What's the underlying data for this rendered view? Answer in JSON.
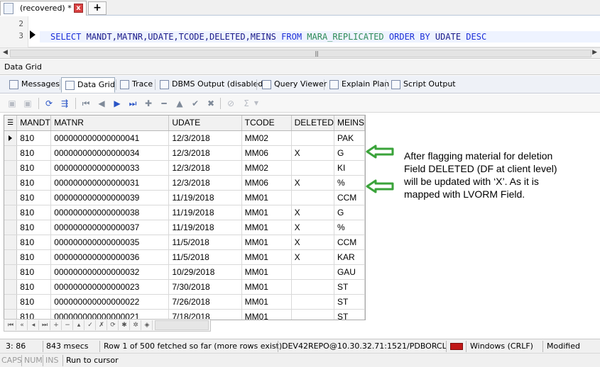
{
  "doc_tab": {
    "title": "(recovered) *",
    "icon_text": "SQL",
    "close_label": "x",
    "new_tab_label": "+"
  },
  "editor": {
    "line_numbers": [
      "2",
      "3"
    ],
    "sql": {
      "select": "SELECT",
      "columns": "MANDT,MATNR,UDATE,TCODE,DELETED,MEINS",
      "from": "FROM",
      "table": "MARA_REPLICATED",
      "order_by": "ORDER BY",
      "order_col": "UDATE",
      "desc": "DESC"
    }
  },
  "pane_title": "Data Grid",
  "result_tabs": [
    {
      "label": "Messages",
      "icon": "messages-icon"
    },
    {
      "label": "Data Grid",
      "icon": "data-grid-icon",
      "active": true
    },
    {
      "label": "Trace",
      "icon": "trace-icon"
    },
    {
      "label": "DBMS Output (disabled)",
      "icon": "dbms-output-icon"
    },
    {
      "label": "Query Viewer",
      "icon": "query-viewer-icon"
    },
    {
      "label": "Explain Plan",
      "icon": "explain-plan-icon"
    },
    {
      "label": "Script Output",
      "icon": "script-output-icon"
    }
  ],
  "grid": {
    "columns": [
      "MANDT",
      "MATNR",
      "UDATE",
      "TCODE",
      "DELETED",
      "MEINS"
    ],
    "rows": [
      [
        "810",
        "000000000000000041",
        "12/3/2018",
        "MM02",
        "",
        "PAK"
      ],
      [
        "810",
        "000000000000000034",
        "12/3/2018",
        "MM06",
        "X",
        "G"
      ],
      [
        "810",
        "000000000000000033",
        "12/3/2018",
        "MM02",
        "",
        "KI"
      ],
      [
        "810",
        "000000000000000031",
        "12/3/2018",
        "MM06",
        "X",
        "%"
      ],
      [
        "810",
        "000000000000000039",
        "11/19/2018",
        "MM01",
        "",
        "CCM"
      ],
      [
        "810",
        "000000000000000038",
        "11/19/2018",
        "MM01",
        "X",
        "G"
      ],
      [
        "810",
        "000000000000000037",
        "11/19/2018",
        "MM01",
        "X",
        "%"
      ],
      [
        "810",
        "000000000000000035",
        "11/5/2018",
        "MM01",
        "X",
        "CCM"
      ],
      [
        "810",
        "000000000000000036",
        "11/5/2018",
        "MM01",
        "X",
        "KAR"
      ],
      [
        "810",
        "000000000000000032",
        "10/29/2018",
        "MM01",
        "",
        "GAU"
      ],
      [
        "810",
        "000000000000000023",
        "7/30/2018",
        "MM01",
        "",
        "ST"
      ],
      [
        "810",
        "000000000000000022",
        "7/26/2018",
        "MM01",
        "",
        "ST"
      ],
      [
        "810",
        "000000000000000021",
        "7/18/2018",
        "MM01",
        "",
        "ST"
      ]
    ]
  },
  "annotation": {
    "lines": [
      "After flagging material for deletion",
      "Field DELETED (DF at client level)",
      "will be updated with ‘X’. As it is",
      "mapped with LVORM Field."
    ],
    "arrow_color": "#3aa33a"
  },
  "status": {
    "position": "3:  86",
    "elapsed": "843 msecs",
    "fetch_info": "Row 1 of 500 fetched so far (more rows exist)",
    "connection": "DEV42REPO@10.30.32.71:1521/PDBORCL",
    "line_endings": "Windows (CRLF)",
    "modified": "Modified",
    "caps": "CAPS",
    "num": "NUM",
    "ins": "INS",
    "action": "Run to cursor"
  },
  "colors": {
    "keyword": "#1c2fd8",
    "table_name": "#2e8b57",
    "active_line": "#eef3ff",
    "flag": "#c01818"
  }
}
